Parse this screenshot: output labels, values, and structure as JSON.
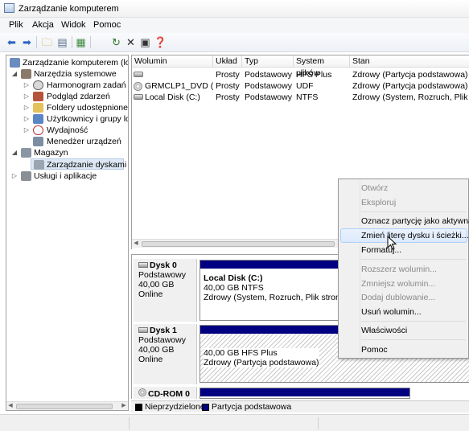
{
  "window": {
    "title": "Zarządzanie komputerem"
  },
  "menu": [
    "Plik",
    "Akcja",
    "Widok",
    "Pomoc"
  ],
  "tree": {
    "root": "Zarządzanie komputerem (loka",
    "system_tools": "Narzędzia systemowe",
    "scheduler": "Harmonogram zadań",
    "event_viewer": "Podgląd zdarzeń",
    "shared_folders": "Foldery udostępnione",
    "users_groups": "Użytkownicy i grupy lok",
    "performance": "Wydajność",
    "device_manager": "Menedżer urządzeń",
    "storage": "Magazyn",
    "disk_mgmt": "Zarządzanie dyskami",
    "services": "Usługi i aplikacje"
  },
  "volumes": {
    "headers": [
      "Wolumin",
      "Układ",
      "Typ",
      "System plików",
      "Stan"
    ],
    "rows": [
      {
        "name": "",
        "layout": "Prosty",
        "type": "Podstawowy",
        "fs": "HFS Plus",
        "status": "Zdrowy (Partycja podstawowa)"
      },
      {
        "name": "GRMCLP1_DVD (D:)",
        "layout": "Prosty",
        "type": "Podstawowy",
        "fs": "UDF",
        "status": "Zdrowy (Partycja podstawowa)"
      },
      {
        "name": "Local Disk (C:)",
        "layout": "Prosty",
        "type": "Podstawowy",
        "fs": "NTFS",
        "status": "Zdrowy (System, Rozruch, Plik stroni"
      }
    ]
  },
  "disks": {
    "disk0": {
      "name": "Dysk 0",
      "type": "Podstawowy",
      "size": "40,00 GB",
      "state": "Online",
      "part_title": "Local Disk  (C:)",
      "part_size": "40,00 GB NTFS",
      "part_status": "Zdrowy (System, Rozruch, Plik stronicow"
    },
    "disk1": {
      "name": "Dysk 1",
      "type": "Podstawowy",
      "size": "40,00 GB",
      "state": "Online",
      "part_size": "40,00 GB HFS Plus",
      "part_status": "Zdrowy (Partycja podstawowa)"
    },
    "cdrom": {
      "name": "CD-ROM 0"
    }
  },
  "legend": {
    "unallocated": "Nieprzydzielone",
    "primary": "Partycja podstawowa",
    "unallocated_color": "#000000",
    "primary_color": "#000080"
  },
  "context_menu": {
    "open": "Otwórz",
    "explore": "Eksploruj",
    "mark_active": "Oznacz partycję jako aktywną",
    "change_letter": "Zmień literę dysku i ścieżki...",
    "format": "Formatuj...",
    "extend": "Rozszerz wolumin...",
    "shrink": "Zmniejsz wolumin...",
    "add_mirror": "Dodaj dublowanie...",
    "delete": "Usuń wolumin...",
    "properties": "Właściwości",
    "help": "Pomoc"
  }
}
